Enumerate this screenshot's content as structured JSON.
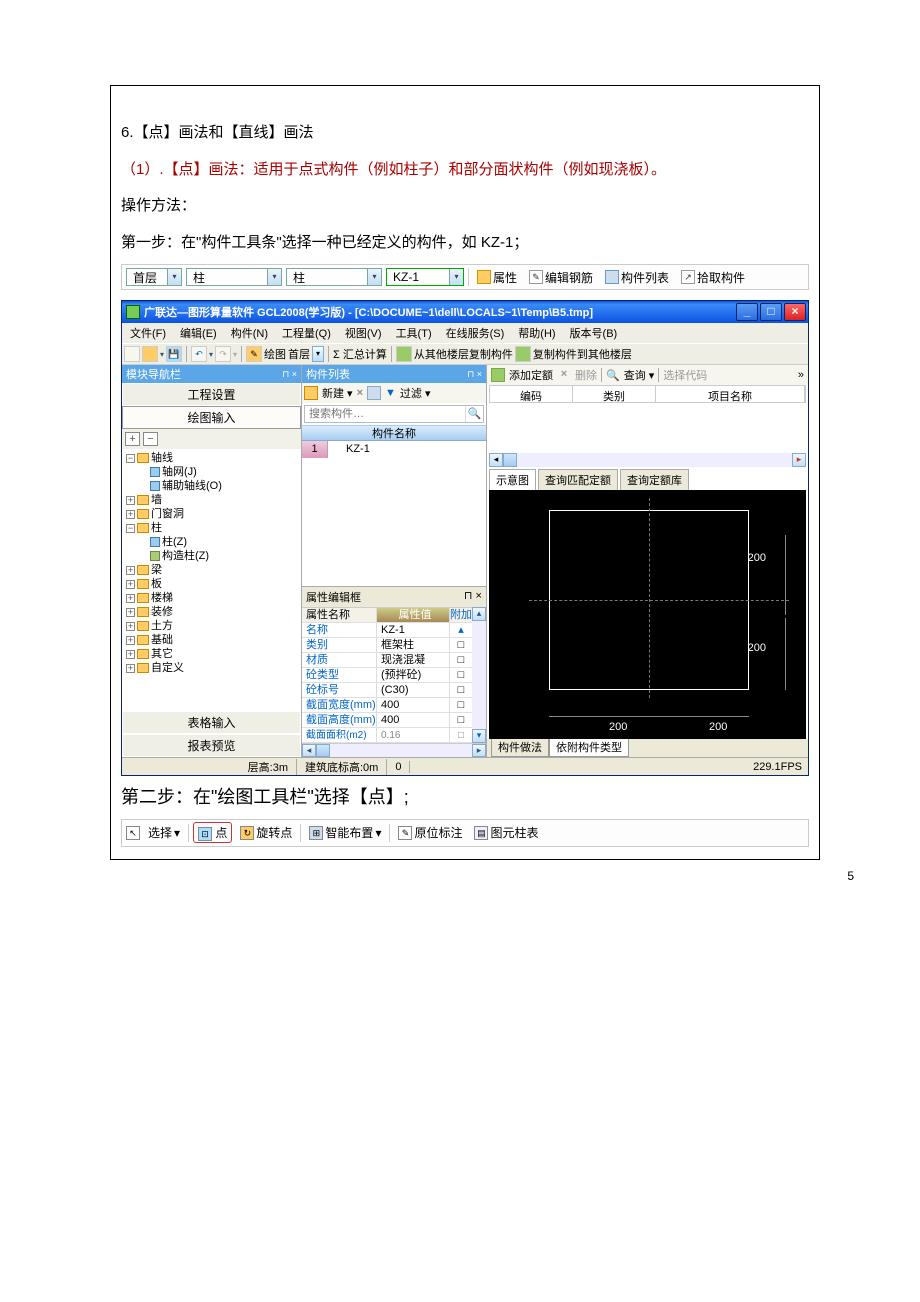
{
  "text": {
    "h1": "6.【点】画法和【直线】画法",
    "p1": "（1）.【点】画法：适用于点式构件（例如柱子）和部分面状构件（例如现浇板）。",
    "p2": "操作方法：",
    "p3a": "第一步：在\"构件工具条\"选择一种已经定义的构件，如 ",
    "p3b": "KZ-1；",
    "step2": "第二步：在\"绘图工具栏\"选择【点】;",
    "pagenum": "5"
  },
  "bar1": {
    "combo1": "首层",
    "combo2": "柱",
    "combo3": "柱",
    "combo4": "KZ-1",
    "btn1": "属性",
    "btn2": "编辑钢筋",
    "btn3": "构件列表",
    "btn4": "拾取构件"
  },
  "app": {
    "title": "广联达—图形算量软件  GCL2008(学习版) - [C:\\DOCUME~1\\dell\\LOCALS~1\\Temp\\B5.tmp]",
    "menu": [
      "文件(F)",
      "编辑(E)",
      "构件(N)",
      "工程量(Q)",
      "视图(V)",
      "工具(T)",
      "在线服务(S)",
      "帮助(H)",
      "版本号(B)"
    ],
    "tb": {
      "draw": "绘图",
      "floor": "首层",
      "sum": "Σ 汇总计算",
      "copyfrom": "从其他楼层复制构件",
      "copyto": "复制构件到其他楼层"
    },
    "nav": {
      "title": "模块导航栏",
      "items": [
        "工程设置",
        "绘图输入",
        "表格输入",
        "报表预览"
      ],
      "tree": {
        "axis": "轴线",
        "grid": "轴网(J)",
        "aux": "辅助轴线(O)",
        "wall": "墙",
        "door": "门窗洞",
        "col": "柱",
        "col_z": "柱(Z)",
        "col_gz": "构造柱(Z)",
        "beam": "梁",
        "slab": "板",
        "stair": "楼梯",
        "deco": "装修",
        "earth": "土方",
        "found": "基础",
        "other": "其它",
        "custom": "自定义"
      }
    },
    "list": {
      "title": "构件列表",
      "new": "新建",
      "filter": "过滤",
      "search_ph": "搜索构件…",
      "header": "构件名称",
      "row1": "KZ-1"
    },
    "prop": {
      "title": "属性编辑框",
      "h1": "属性名称",
      "h2": "属性值",
      "h3": "附加",
      "rows": [
        {
          "n": "名称",
          "v": "KZ-1",
          "c": ""
        },
        {
          "n": "类别",
          "v": "框架柱",
          "c": "□"
        },
        {
          "n": "材质",
          "v": "现浇混凝",
          "c": "□"
        },
        {
          "n": "砼类型",
          "v": "(预拌砼)",
          "c": "□"
        },
        {
          "n": "砼标号",
          "v": "(C30)",
          "c": "□"
        },
        {
          "n": "截面宽度(mm)",
          "v": "400",
          "c": "□"
        },
        {
          "n": "截面高度(mm)",
          "v": "400",
          "c": "□"
        },
        {
          "n": "截面面积(m2)",
          "v": "0.16",
          "c": "□"
        }
      ]
    },
    "right": {
      "add": "添加定额",
      "del": "删除",
      "query": "查询",
      "code": "选择代码",
      "cols": [
        "编码",
        "类别",
        "项目名称"
      ],
      "tab1": "示意图",
      "tab2": "查询匹配定额",
      "tab3": "查询定额库",
      "btab1": "构件做法",
      "btab2": "依附构件类型",
      "dim": "200"
    },
    "status": {
      "lh": "层高:3m",
      "bh": "建筑底标高:0m",
      "z": "0",
      "fps": "229.1FPS"
    }
  },
  "bar2": {
    "sel": "选择",
    "pt": "点",
    "rot": "旋转点",
    "smart": "智能布置",
    "orig": "原位标注",
    "table": "图元柱表"
  }
}
